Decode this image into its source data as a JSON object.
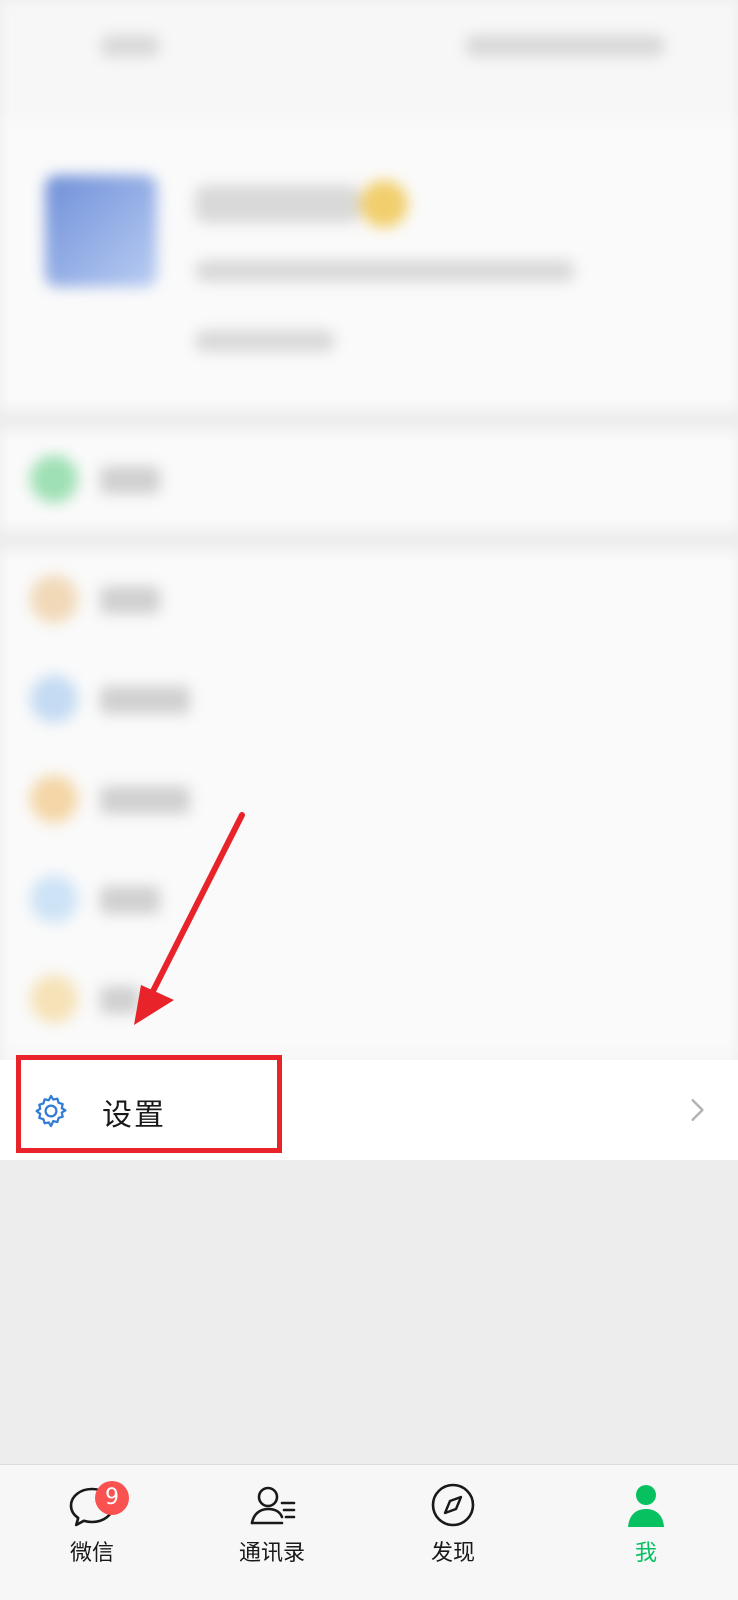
{
  "settings": {
    "label": "设置"
  },
  "tabbar": {
    "tabs": [
      {
        "label": "微信",
        "badge": "9",
        "icon": "chat-icon"
      },
      {
        "label": "通讯录",
        "icon": "contacts-icon"
      },
      {
        "label": "发现",
        "icon": "compass-icon"
      },
      {
        "label": "我",
        "icon": "person-icon",
        "active": true
      }
    ]
  },
  "colors": {
    "accent": "#07c160",
    "highlight": "#e8232a",
    "gear": "#2f7bd6",
    "badge": "#fa5151"
  }
}
